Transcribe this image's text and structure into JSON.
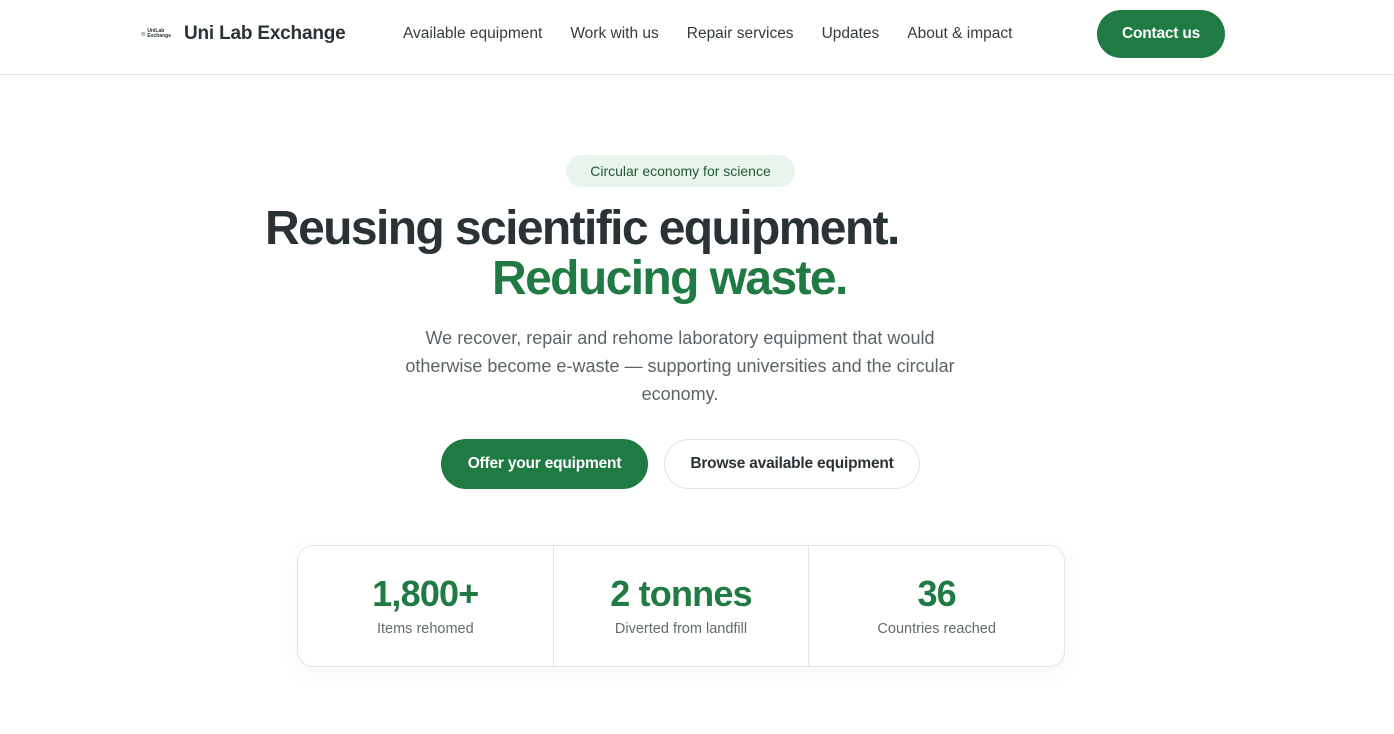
{
  "header": {
    "brand": "Uni Lab Exchange",
    "logo_small_text": [
      "UniLab",
      "Exchange"
    ],
    "nav": [
      {
        "label": "Available equipment"
      },
      {
        "label": "Work with us"
      },
      {
        "label": "Repair services"
      },
      {
        "label": "Updates"
      },
      {
        "label": "About & impact"
      }
    ],
    "contact_label": "Contact us"
  },
  "hero": {
    "eyebrow": "Circular economy for science",
    "title_line1": "Reusing scientific equipment.",
    "title_line2": "Reducing waste.",
    "subtitle": "We recover, repair and rehome laboratory equipment that would otherwise become e-waste — supporting universities and the circular economy.",
    "primary_cta": "Offer your equipment",
    "secondary_cta": "Browse available equipment"
  },
  "stats": [
    {
      "value": "1,800+",
      "label": "Items rehomed"
    },
    {
      "value": "2 tonnes",
      "label": "Diverted from landfill"
    },
    {
      "value": "36",
      "label": "Countries reached"
    }
  ],
  "colors": {
    "accent": "#1f7a43",
    "text": "#2b3236",
    "eyebrow_bg": "#e8f4ec"
  },
  "icons": {
    "logo": "recycle-globe-icon"
  }
}
